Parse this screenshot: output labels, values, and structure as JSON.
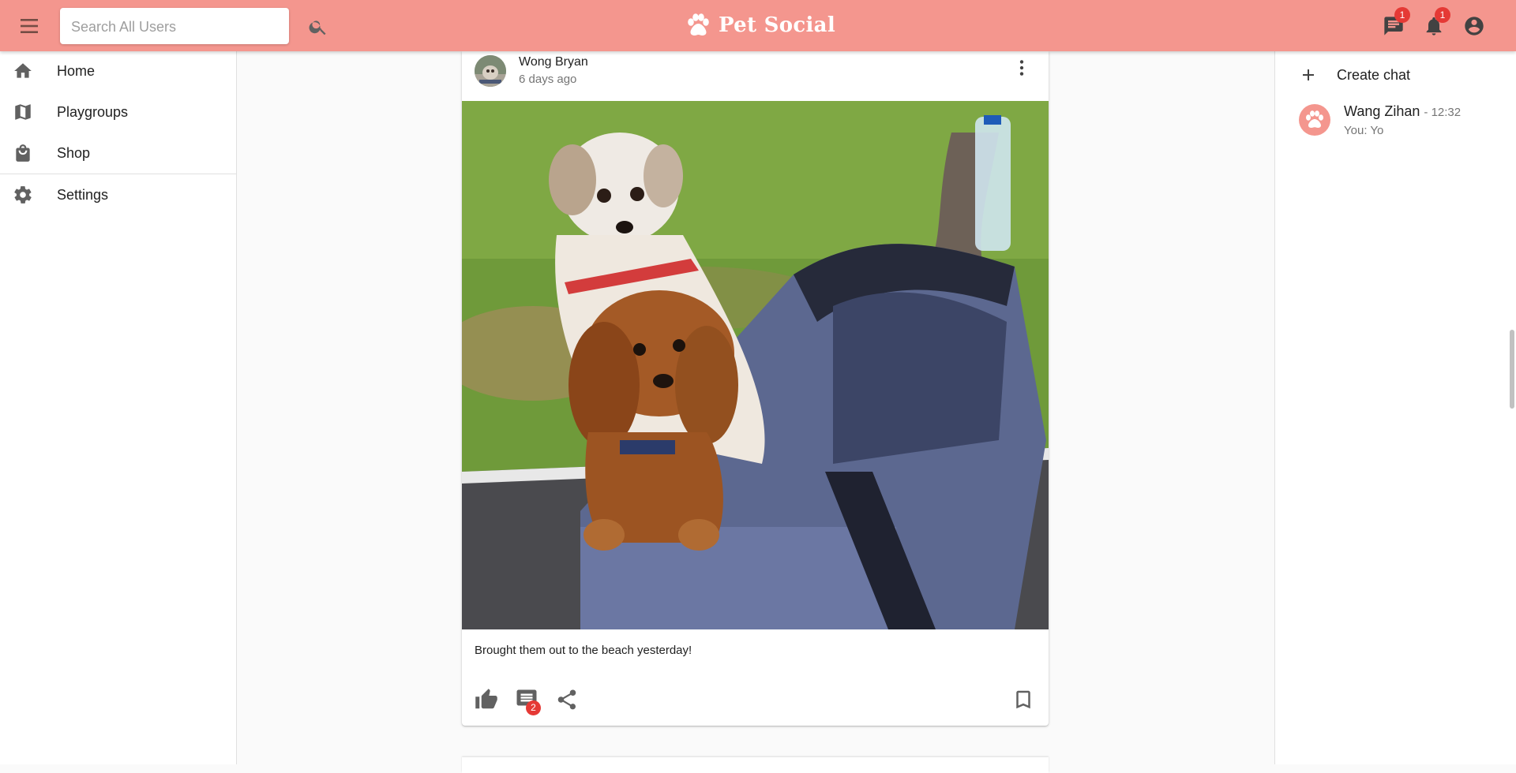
{
  "header": {
    "brand_title": "Pet Social",
    "search_placeholder": "Search All Users",
    "messages_badge": "1",
    "notifications_badge": "1",
    "bar_color": "#f4968e"
  },
  "sidebar": {
    "items": [
      {
        "label": "Home",
        "icon": "home-icon"
      },
      {
        "label": "Playgroups",
        "icon": "map-icon"
      },
      {
        "label": "Shop",
        "icon": "shopping-bag-icon"
      },
      {
        "label": "Settings",
        "icon": "gear-icon"
      }
    ]
  },
  "post": {
    "author": "Wong Bryan",
    "time": "6 days ago",
    "caption": "Brought them out to the beach yesterday!",
    "comment_count": "2"
  },
  "chat": {
    "create_label": "Create chat",
    "conversations": [
      {
        "name": "Wang Zihan",
        "time": "- 12:32",
        "preview": "You: Yo"
      }
    ]
  },
  "colors": {
    "accent": "#f4968e",
    "badge": "#e53935",
    "icon": "#616161"
  }
}
